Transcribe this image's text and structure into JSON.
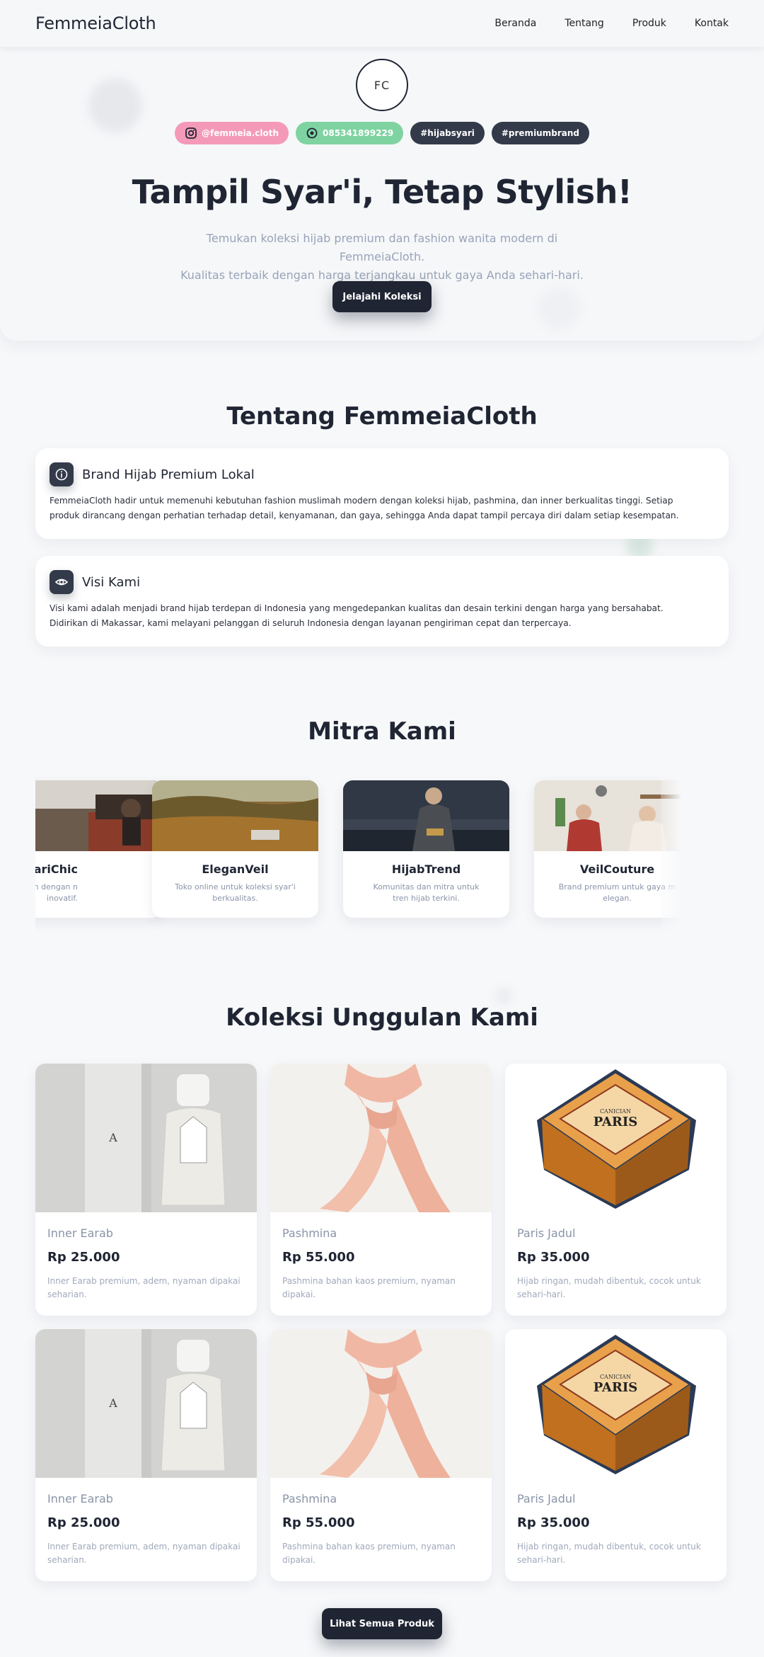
{
  "nav": {
    "brand": "FemmeiaCloth",
    "links": [
      "Beranda",
      "Tentang",
      "Produk",
      "Kontak"
    ]
  },
  "hero": {
    "logo_text": "FC",
    "chips": [
      {
        "label": "@femmeia.cloth",
        "icon": "instagram-icon"
      },
      {
        "label": "085341899229",
        "icon": "whatsapp-icon"
      },
      {
        "label": "#hijabsyari"
      },
      {
        "label": "#premiumbrand"
      }
    ],
    "title": "Tampil Syar'i, Tetap Stylish!",
    "subtitle_line1": "Temukan koleksi hijab premium dan fashion wanita modern di FemmeiaCloth.",
    "subtitle_line2": "Kualitas terbaik dengan harga terjangkau untuk gaya Anda sehari-hari.",
    "cta": "Jelajahi Koleksi"
  },
  "about": {
    "title": "Tentang FemmeiaCloth",
    "cards": [
      {
        "icon": "info-icon",
        "title": "Brand Hijab Premium Lokal",
        "line1": "FemmeiaCloth hadir untuk memenuhi kebutuhan fashion muslimah modern dengan koleksi hijab, pashmina, dan inner berkualitas tinggi. Setiap",
        "line2": "produk dirancang dengan perhatian terhadap detail, kenyamanan, dan gaya, sehingga Anda dapat tampil percaya diri dalam setiap kesempatan."
      },
      {
        "icon": "eye-icon",
        "title": "Visi Kami",
        "line1": "Visi kami adalah menjadi brand hijab terdepan di Indonesia yang mengedepankan kualitas dan desain terkini dengan harga yang bersahabat.",
        "line2": "Didirikan di Makassar, kami melayani pelanggan di seluruh Indonesia dengan layanan pengiriman cepat dan terpercaya."
      }
    ]
  },
  "partners": {
    "title": "Mitra Kami",
    "items": [
      {
        "name": "ariChic",
        "desc": "muslimah dengan n inovatif."
      },
      {
        "name": "EleganVeil",
        "desc": "Toko online untuk koleksi syar'i berkualitas."
      },
      {
        "name": "HijabTrend",
        "desc": "Komunitas dan mitra untuk tren hijab terkini."
      },
      {
        "name": "VeilCouture",
        "desc": "Brand premium untuk gaya m elegan."
      }
    ]
  },
  "products": {
    "title": "Koleksi Unggulan Kami",
    "items": [
      {
        "name": "Inner Earab",
        "price": "Rp 25.000",
        "desc": "Inner Earab premium, adem, nyaman dipakai seharian."
      },
      {
        "name": "Pashmina",
        "price": "Rp 55.000",
        "desc": "Pashmina bahan kaos premium, nyaman dipakai."
      },
      {
        "name": "Paris Jadul",
        "price": "Rp 35.000",
        "desc": "Hijab ringan, mudah dibentuk, cocok untuk sehari-hari."
      },
      {
        "name": "Inner Earab",
        "price": "Rp 25.000",
        "desc": "Inner Earab premium, adem, nyaman dipakai seharian."
      },
      {
        "name": "Pashmina",
        "price": "Rp 55.000",
        "desc": "Pashmina bahan kaos premium, nyaman dipakai."
      },
      {
        "name": "Paris Jadul",
        "price": "Rp 35.000",
        "desc": "Hijab ringan, mudah dibentuk, cocok untuk sehari-hari."
      }
    ],
    "product_image_text": {
      "bottle_letter": "A",
      "box_brand": "PARIS",
      "box_top": "CANICIAN"
    },
    "cta": "Lihat Semua Produk"
  },
  "colors": {
    "primary": "#1f2533",
    "instagram_chip": "#f49ab8",
    "whatsapp_chip": "#7fd3a1",
    "muted_text": "#8a94a8"
  }
}
